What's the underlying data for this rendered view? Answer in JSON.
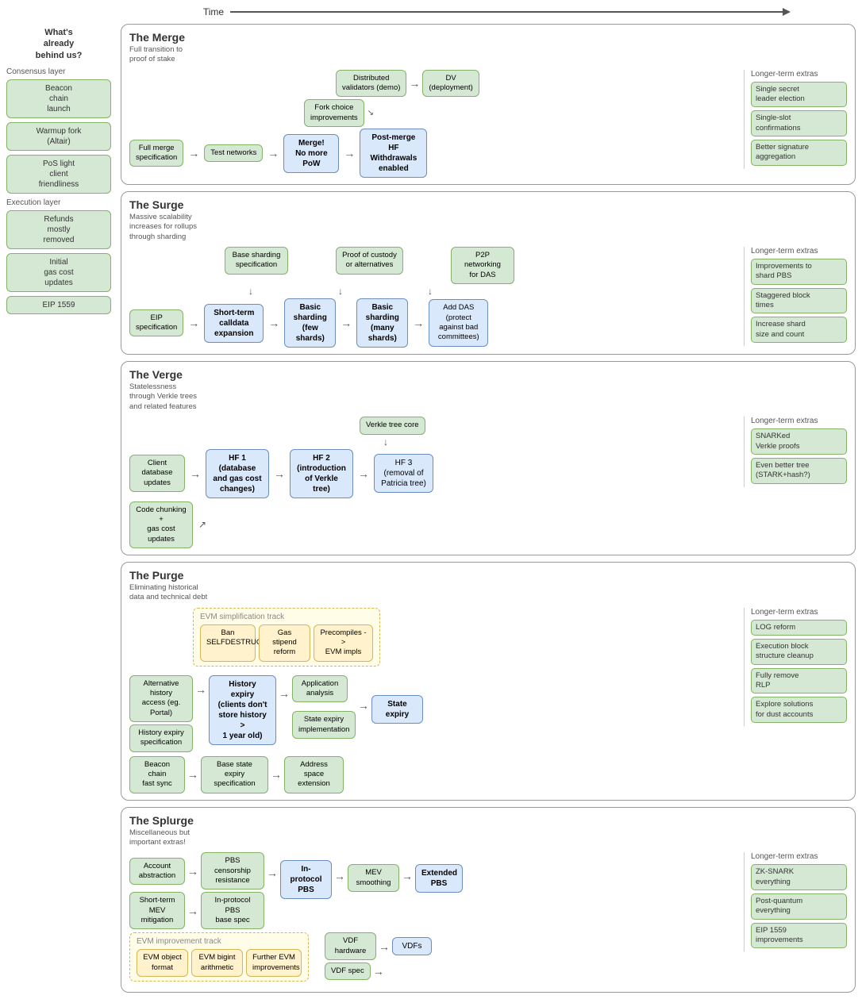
{
  "time": {
    "label": "Time"
  },
  "sidebar": {
    "title": "What's\nalready\nbehind us?",
    "sections": [
      {
        "label": "Consensus layer",
        "items": [
          "Beacon\nchain\nlaunch",
          "Warmup fork\n(Altair)",
          "PoS light\nclient\nfriendliness"
        ]
      },
      {
        "label": "Execution layer",
        "items": [
          "Refunds\nmostly\nremoved",
          "Initial\ngas cost\nupdates",
          "EIP 1559"
        ]
      }
    ]
  },
  "sections": {
    "merge": {
      "title": "The Merge",
      "subtitle": "Full transition to\nproof of stake",
      "extras_title": "Longer-term extras",
      "extras": [
        "Single secret\nleader election",
        "Single-slot\nconfirmations",
        "Better signature\naggregation"
      ],
      "flow": {
        "top_boxes": [
          "Distributed\nvalidators (demo)",
          "DV\n(deployment)"
        ],
        "mid_boxes": [
          "Fork choice\nimprovements"
        ],
        "main_row": [
          "Full merge\nspecification",
          "Test networks",
          "Merge!\nNo more\nPoW",
          "Post-merge\nHF\nWithdrawals\nenabled"
        ]
      }
    },
    "surge": {
      "title": "The Surge",
      "subtitle": "Massive scalability\nincreases for rollups\nthrough sharding",
      "extras_title": "Longer-term extras",
      "extras": [
        "Improvements to\nshard PBS",
        "Staggered block\ntimes",
        "Increase shard\nsize and count"
      ],
      "flow": {
        "top_hint1": "Base sharding\nspecification",
        "top_hint2": "Proof of custody\nor alternatives",
        "top_hint3": "P2P networking\nfor DAS",
        "main": [
          "EIP\nspecification",
          "Short-term\ncalldata\nexpansion",
          "Basic\nsharding\n(few shards)",
          "Basic\nsharding\n(many\nshards)",
          "Add DAS\n(protect\nagainst bad\ncommittees)"
        ]
      }
    },
    "verge": {
      "title": "The Verge",
      "subtitle": "Statelessness\nthrough Verkle trees\nand related features",
      "extras_title": "Longer-term extras",
      "extras": [
        "SNARKed\nVerkle proofs",
        "Even better tree\n(STARK+hash?)"
      ],
      "flow": {
        "top_hint": "Verkle tree core",
        "top_row": [
          "Client database\nupdates",
          "HF 1\n(database\nand gas cost\nchanges)",
          "HF 2\n(introduction\nof Verkle\ntree)",
          "HF 3\n(removal of\nPatricia tree)"
        ],
        "bottom_box": "Code chunking +\ngas cost updates"
      }
    },
    "purge": {
      "title": "The Purge",
      "subtitle": "Eliminating historical\ndata and technical debt",
      "extras_title": "Longer-term extras",
      "extras": [
        "LOG reform",
        "Execution block\nstructure cleanup",
        "Fully remove\nRLP",
        "Explore solutions\nfor dust accounts"
      ],
      "evm_track": {
        "title": "EVM simplification track",
        "boxes": [
          "Ban\nSELFDESTRUCT",
          "Gas stipend\nreform",
          "Precompiles ->\nEVM impls"
        ]
      },
      "flow": {
        "top1": "Alternative history\naccess (eg. Portal)",
        "top2": "History expiry\nspecification",
        "top3": "Beacon chain\nfast sync",
        "history_expiry": "History\nexpiry\n(clients don't\nstore history >\n1 year old)",
        "app_analysis": "Application\nanalysis",
        "base_state": "Base state expiry\nspecification",
        "addr_space": "Address space\nextension",
        "state_expiry_impl": "State expiry\nimplementation",
        "state_expiry": "State expiry"
      }
    },
    "splurge": {
      "title": "The Splurge",
      "subtitle": "Miscellaneous but\nimportant extras!",
      "extras_title": "Longer-term extras",
      "extras": [
        "ZK-SNARK\neverything",
        "Post-quantum\neverything",
        "EIP 1559\nimprovements"
      ],
      "flow": {
        "top_boxes": [
          "Account\nabstraction",
          "PBS censorship\nresistance",
          "Short-term MEV\nmitigation",
          "In-protocol PBS\nbase spec"
        ],
        "in_protocol_pbs": "In-protocol\nPBS",
        "mev_smoothing": "MEV smoothing",
        "extended_pbs": "Extended\nPBS",
        "evm_track": {
          "title": "EVM improvement track",
          "boxes": [
            "EVM object\nformat",
            "EVM bigint\narithmetic",
            "Further EVM\nimprovements"
          ]
        },
        "vdf_spec": "VDF spec",
        "vdf_hardware": "VDF hardware",
        "vdfs": "VDFs"
      }
    }
  }
}
